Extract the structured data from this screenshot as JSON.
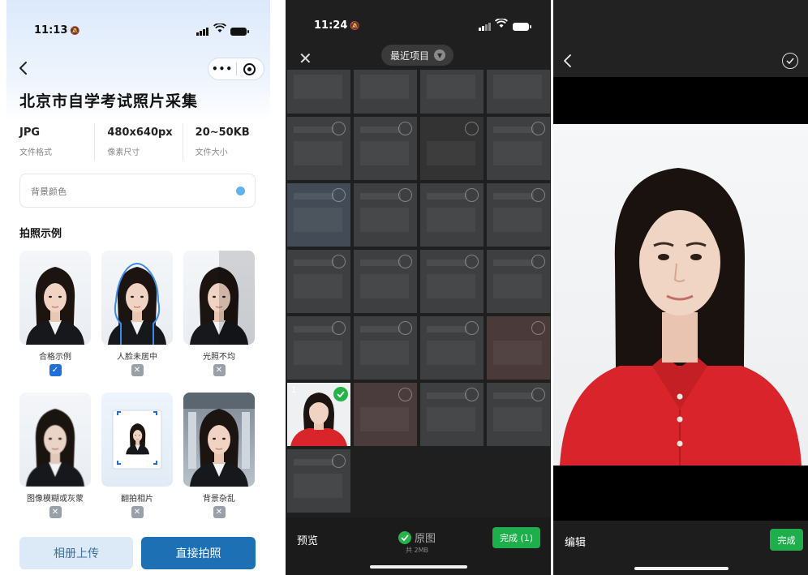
{
  "panel1": {
    "time": "11:13",
    "title": "北京市自学考试照片采集",
    "specs": [
      {
        "value": "JPG",
        "label": "文件格式"
      },
      {
        "value": "480x640px",
        "label": "像素尺寸"
      },
      {
        "value": "20~50KB",
        "label": "文件大小"
      }
    ],
    "bg_color_label": "背景颜色",
    "bg_color_value": "#5fb3ee",
    "section_title": "拍照示例",
    "examples": [
      {
        "caption": "合格示例",
        "status": "ok",
        "mark": "✓"
      },
      {
        "caption": "人脸未居中",
        "status": "no",
        "mark": "✕"
      },
      {
        "caption": "光照不均",
        "status": "no",
        "mark": "✕"
      },
      {
        "caption": "图像模糊或灰蒙",
        "status": "no",
        "mark": "✕"
      },
      {
        "caption": "翻拍相片",
        "status": "no",
        "mark": "✕"
      },
      {
        "caption": "背景杂乱",
        "status": "no",
        "mark": "✕"
      }
    ],
    "album_button": "相册上传",
    "shoot_button": "直接拍照"
  },
  "panel2": {
    "time": "11:24",
    "album_title": "最近项目",
    "selected_index": "1",
    "preview_label": "预览",
    "original_label": "原图",
    "original_size": "共 2MB",
    "done_label": "完成 (1)"
  },
  "panel3": {
    "edit_label": "编辑",
    "done_label": "完成"
  },
  "colors": {
    "accent_blue": "#1e70b5",
    "wechat_green": "#1fae4c",
    "shirt_red": "#d8242a"
  }
}
